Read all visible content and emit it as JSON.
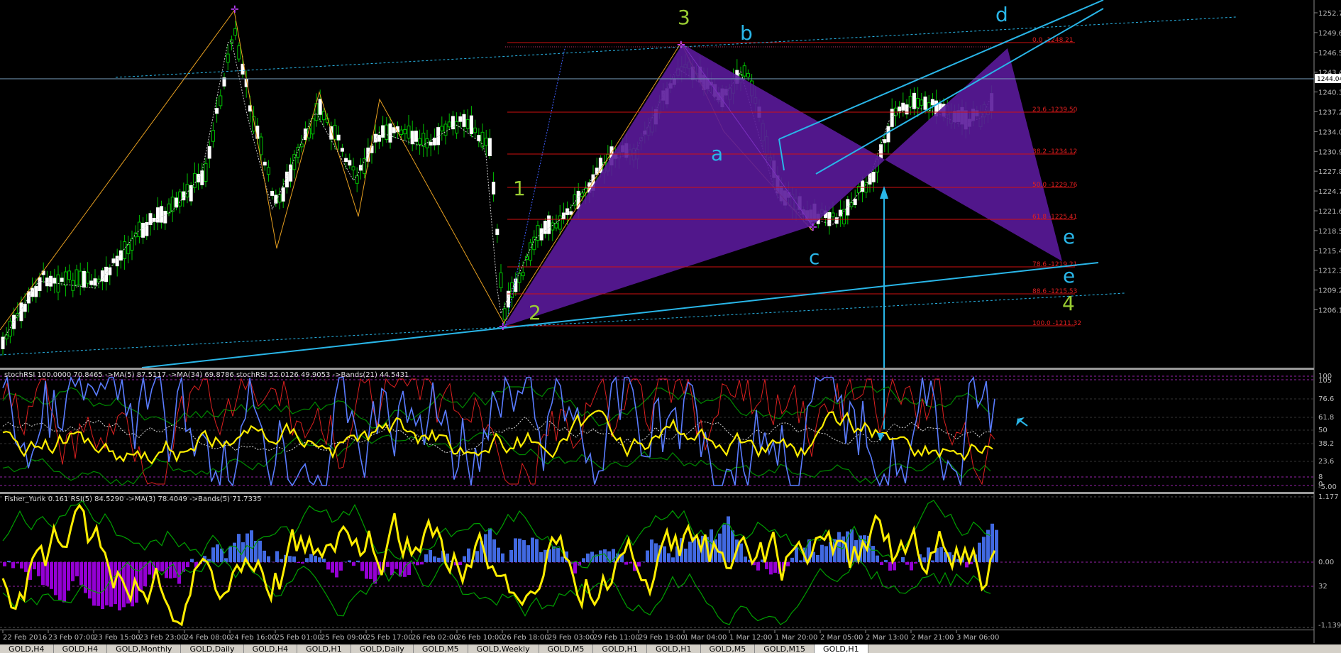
{
  "price_axis": [
    "1252.70",
    "1249.60",
    "1246.50",
    "1243.40",
    "1240.30",
    "1237.20",
    "1234.05",
    "1230.95",
    "1227.85",
    "1224.75",
    "1221.65",
    "1218.55",
    "1215.45",
    "1212.35",
    "1209.20",
    "1206.10"
  ],
  "current_price": "1244.04",
  "fib_levels": [
    {
      "label": "0.0  -1248.21"
    },
    {
      "label": "23.6  -1239.50"
    },
    {
      "label": "38.2  -1234.12"
    },
    {
      "label": "50.0  -1229.76"
    },
    {
      "label": "61.8  -1225.41"
    },
    {
      "label": "78.6  -1219.21"
    },
    {
      "label": "88.6  -1215.53"
    },
    {
      "label": "100.0  -1211.32"
    }
  ],
  "wave_labels": {
    "w1": "1",
    "w2": "2",
    "w3": "3",
    "w4": "4",
    "a": "a",
    "b": "b",
    "c": "c",
    "d": "d",
    "e1": "e",
    "e2": "e"
  },
  "stoch_header": "stochRSI 100.0000 70.8465  ->MA(5) 87.5117  ->MA(34) 69.8786  stochRSI 52.0126 49.9053  ->Bands(21) 44.5431",
  "stoch_axis": [
    "100",
    "105",
    "76.6",
    "61.8",
    "50",
    "38.2",
    "23.6",
    "8",
    "0",
    "-5.00"
  ],
  "fisher_header": "Fisher_Yurik 0.161  RSI(5) 84.5290  ->MA(3) 78.4049  ->Bands(5) 71.7335",
  "fisher_axis": [
    "1.177",
    "0.00",
    "32",
    "-1.139"
  ],
  "time_axis": [
    "22 Feb 2016",
    "23 Feb 07:00",
    "23 Feb 15:00",
    "23 Feb 23:00",
    "24 Feb 08:00",
    "24 Feb 16:00",
    "25 Feb 01:00",
    "25 Feb 09:00",
    "25 Feb 17:00",
    "26 Feb 02:00",
    "26 Feb 10:00",
    "26 Feb 18:00",
    "29 Feb 03:00",
    "29 Feb 11:00",
    "29 Feb 19:00",
    "1 Mar 04:00",
    "1 Mar 12:00",
    "1 Mar 20:00",
    "2 Mar 05:00",
    "2 Mar 13:00",
    "2 Mar 21:00",
    "3 Mar 06:00"
  ],
  "tabs": [
    "GOLD,H4",
    "GOLD,H4",
    "GOLD,Monthly",
    "GOLD,Daily",
    "GOLD,H4",
    "GOLD,H1",
    "GOLD,Daily",
    "GOLD,M5",
    "GOLD,Weekly",
    "GOLD,M5",
    "GOLD,H1",
    "GOLD,H1",
    "GOLD,M5",
    "GOLD,M15",
    "GOLD,H1"
  ],
  "active_tab_index": 14,
  "colors": {
    "bull_candle": "#00c000",
    "bear_candle": "#ffffff",
    "fib": "#d01010",
    "pattern": "#5a1a9a",
    "channel": "#29b6e8",
    "wave_green": "#9acd32",
    "wave_blue": "#29b6e8",
    "stoch_yellow": "#ffee00",
    "hist_blue": "#4169e1",
    "hist_purple": "#9400d3"
  },
  "icons": [
    "cursor-arrow-icon"
  ]
}
